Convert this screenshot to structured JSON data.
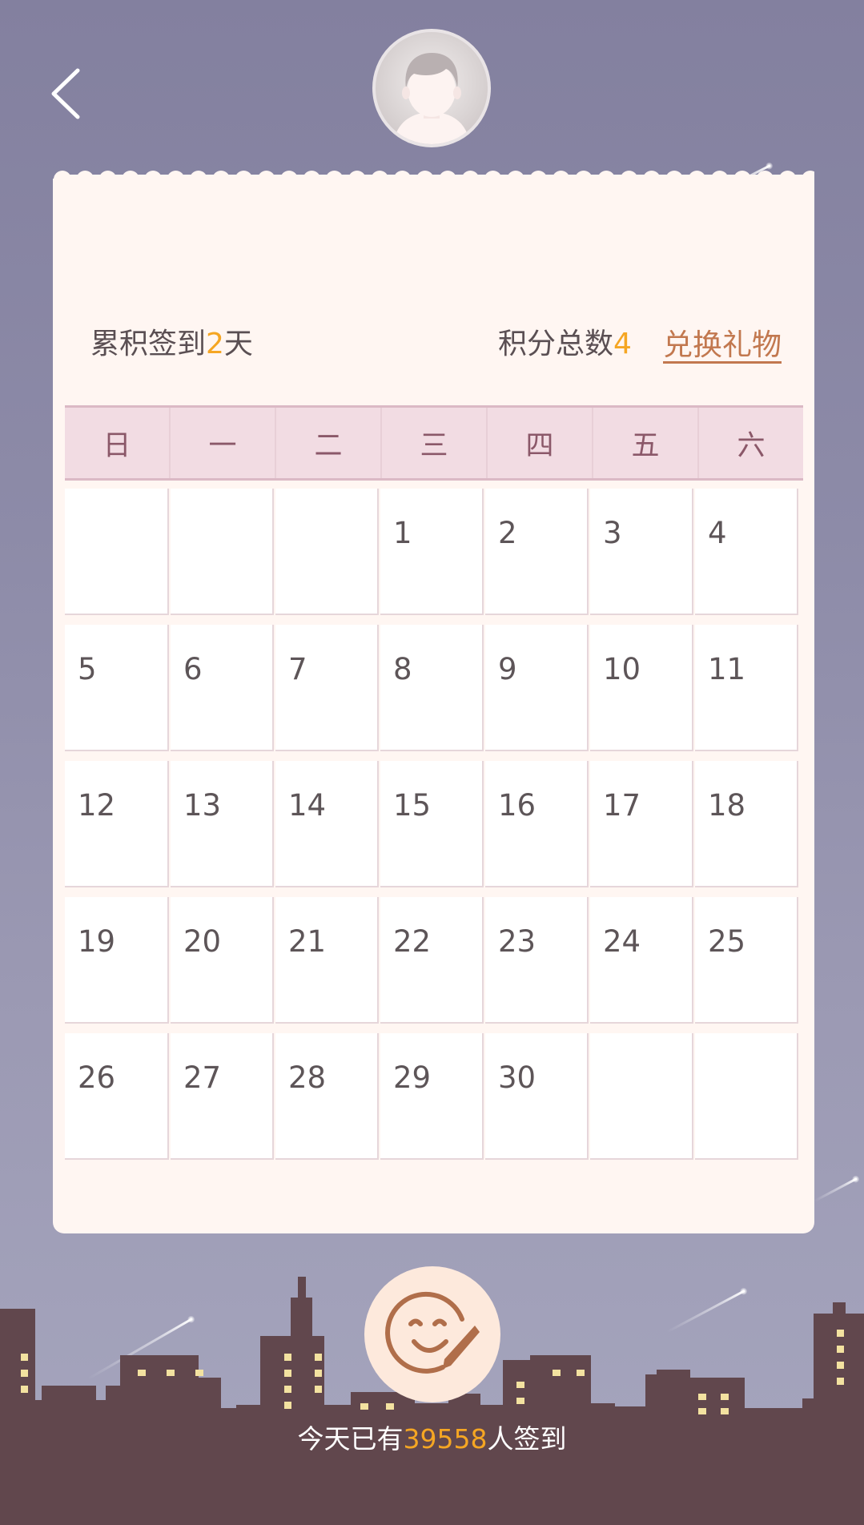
{
  "header": {
    "back_icon": "chevron-left-icon",
    "avatar_icon": "user-avatar-icon"
  },
  "stats": {
    "sign_prefix": "累积签到",
    "sign_days": "2",
    "sign_suffix": "天",
    "points_label": "积分总数",
    "points_value": "4",
    "exchange_label": "兑换礼物"
  },
  "calendar": {
    "weekdays": [
      "日",
      "一",
      "二",
      "三",
      "四",
      "五",
      "六"
    ],
    "weeks": [
      [
        "",
        "",
        "",
        "1",
        "2",
        "3",
        "4"
      ],
      [
        "5",
        "6",
        "7",
        "8",
        "9",
        "10",
        "11"
      ],
      [
        "12",
        "13",
        "14",
        "15",
        "16",
        "17",
        "18"
      ],
      [
        "19",
        "20",
        "21",
        "22",
        "23",
        "24",
        "25"
      ],
      [
        "26",
        "27",
        "28",
        "29",
        "30",
        "",
        ""
      ]
    ]
  },
  "footer": {
    "signin_icon": "smiley-pencil-icon",
    "count_prefix": "今天已有",
    "count_value": "39558",
    "count_suffix": "人签到"
  },
  "colors": {
    "accent": "#f5a623",
    "link": "#c2784f",
    "card": "#fff6f2",
    "header_row": "#f2dce3",
    "city": "#61474d",
    "window_light": "#f3e2a0"
  }
}
